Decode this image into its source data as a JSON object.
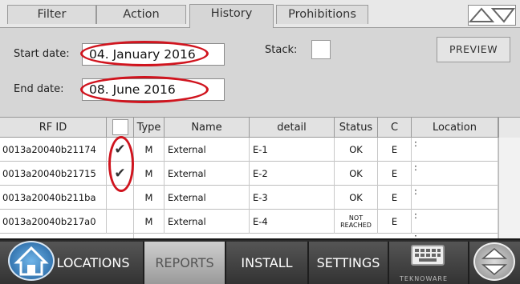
{
  "tabs": [
    {
      "label": "Filter"
    },
    {
      "label": "Action"
    },
    {
      "label": "History"
    },
    {
      "label": "Prohibitions"
    }
  ],
  "filters": {
    "start_label": "Start date:",
    "start_value": "04. January 2016",
    "end_label": "End date:",
    "end_value": "08. June 2016",
    "stack_label": "Stack:",
    "preview_label": "PREVIEW"
  },
  "table": {
    "columns": [
      "RF ID",
      "",
      "Type",
      "Name",
      "detail",
      "Status",
      "C",
      "Location"
    ],
    "rows": [
      {
        "rfid": "0013a20040b21174",
        "checked": "✔",
        "type": "M",
        "name": "External",
        "detail": "E-1",
        "status": "OK",
        "c": "E",
        "location": ":"
      },
      {
        "rfid": "0013a20040b21715",
        "checked": "✔",
        "type": "M",
        "name": "External",
        "detail": "E-2",
        "status": "OK",
        "c": "E",
        "location": ":"
      },
      {
        "rfid": "0013a20040b211ba",
        "checked": "",
        "type": "M",
        "name": "External",
        "detail": "E-3",
        "status": "OK",
        "c": "E",
        "location": ":"
      },
      {
        "rfid": "0013a20040b217a0",
        "checked": "",
        "type": "M",
        "name": "External",
        "detail": "E-4",
        "status_line1": "NOT",
        "status_line2": "REACHED",
        "c": "E",
        "location": ":"
      }
    ],
    "partial_location": ":"
  },
  "nav": {
    "locations": "LOCATIONS",
    "reports": "REPORTS",
    "install": "INSTALL",
    "settings": "SETTINGS"
  },
  "logo": "TEKNOWARE",
  "colors": {
    "highlight_ring": "#d0141e",
    "active_nav": "#bdbdbd"
  }
}
